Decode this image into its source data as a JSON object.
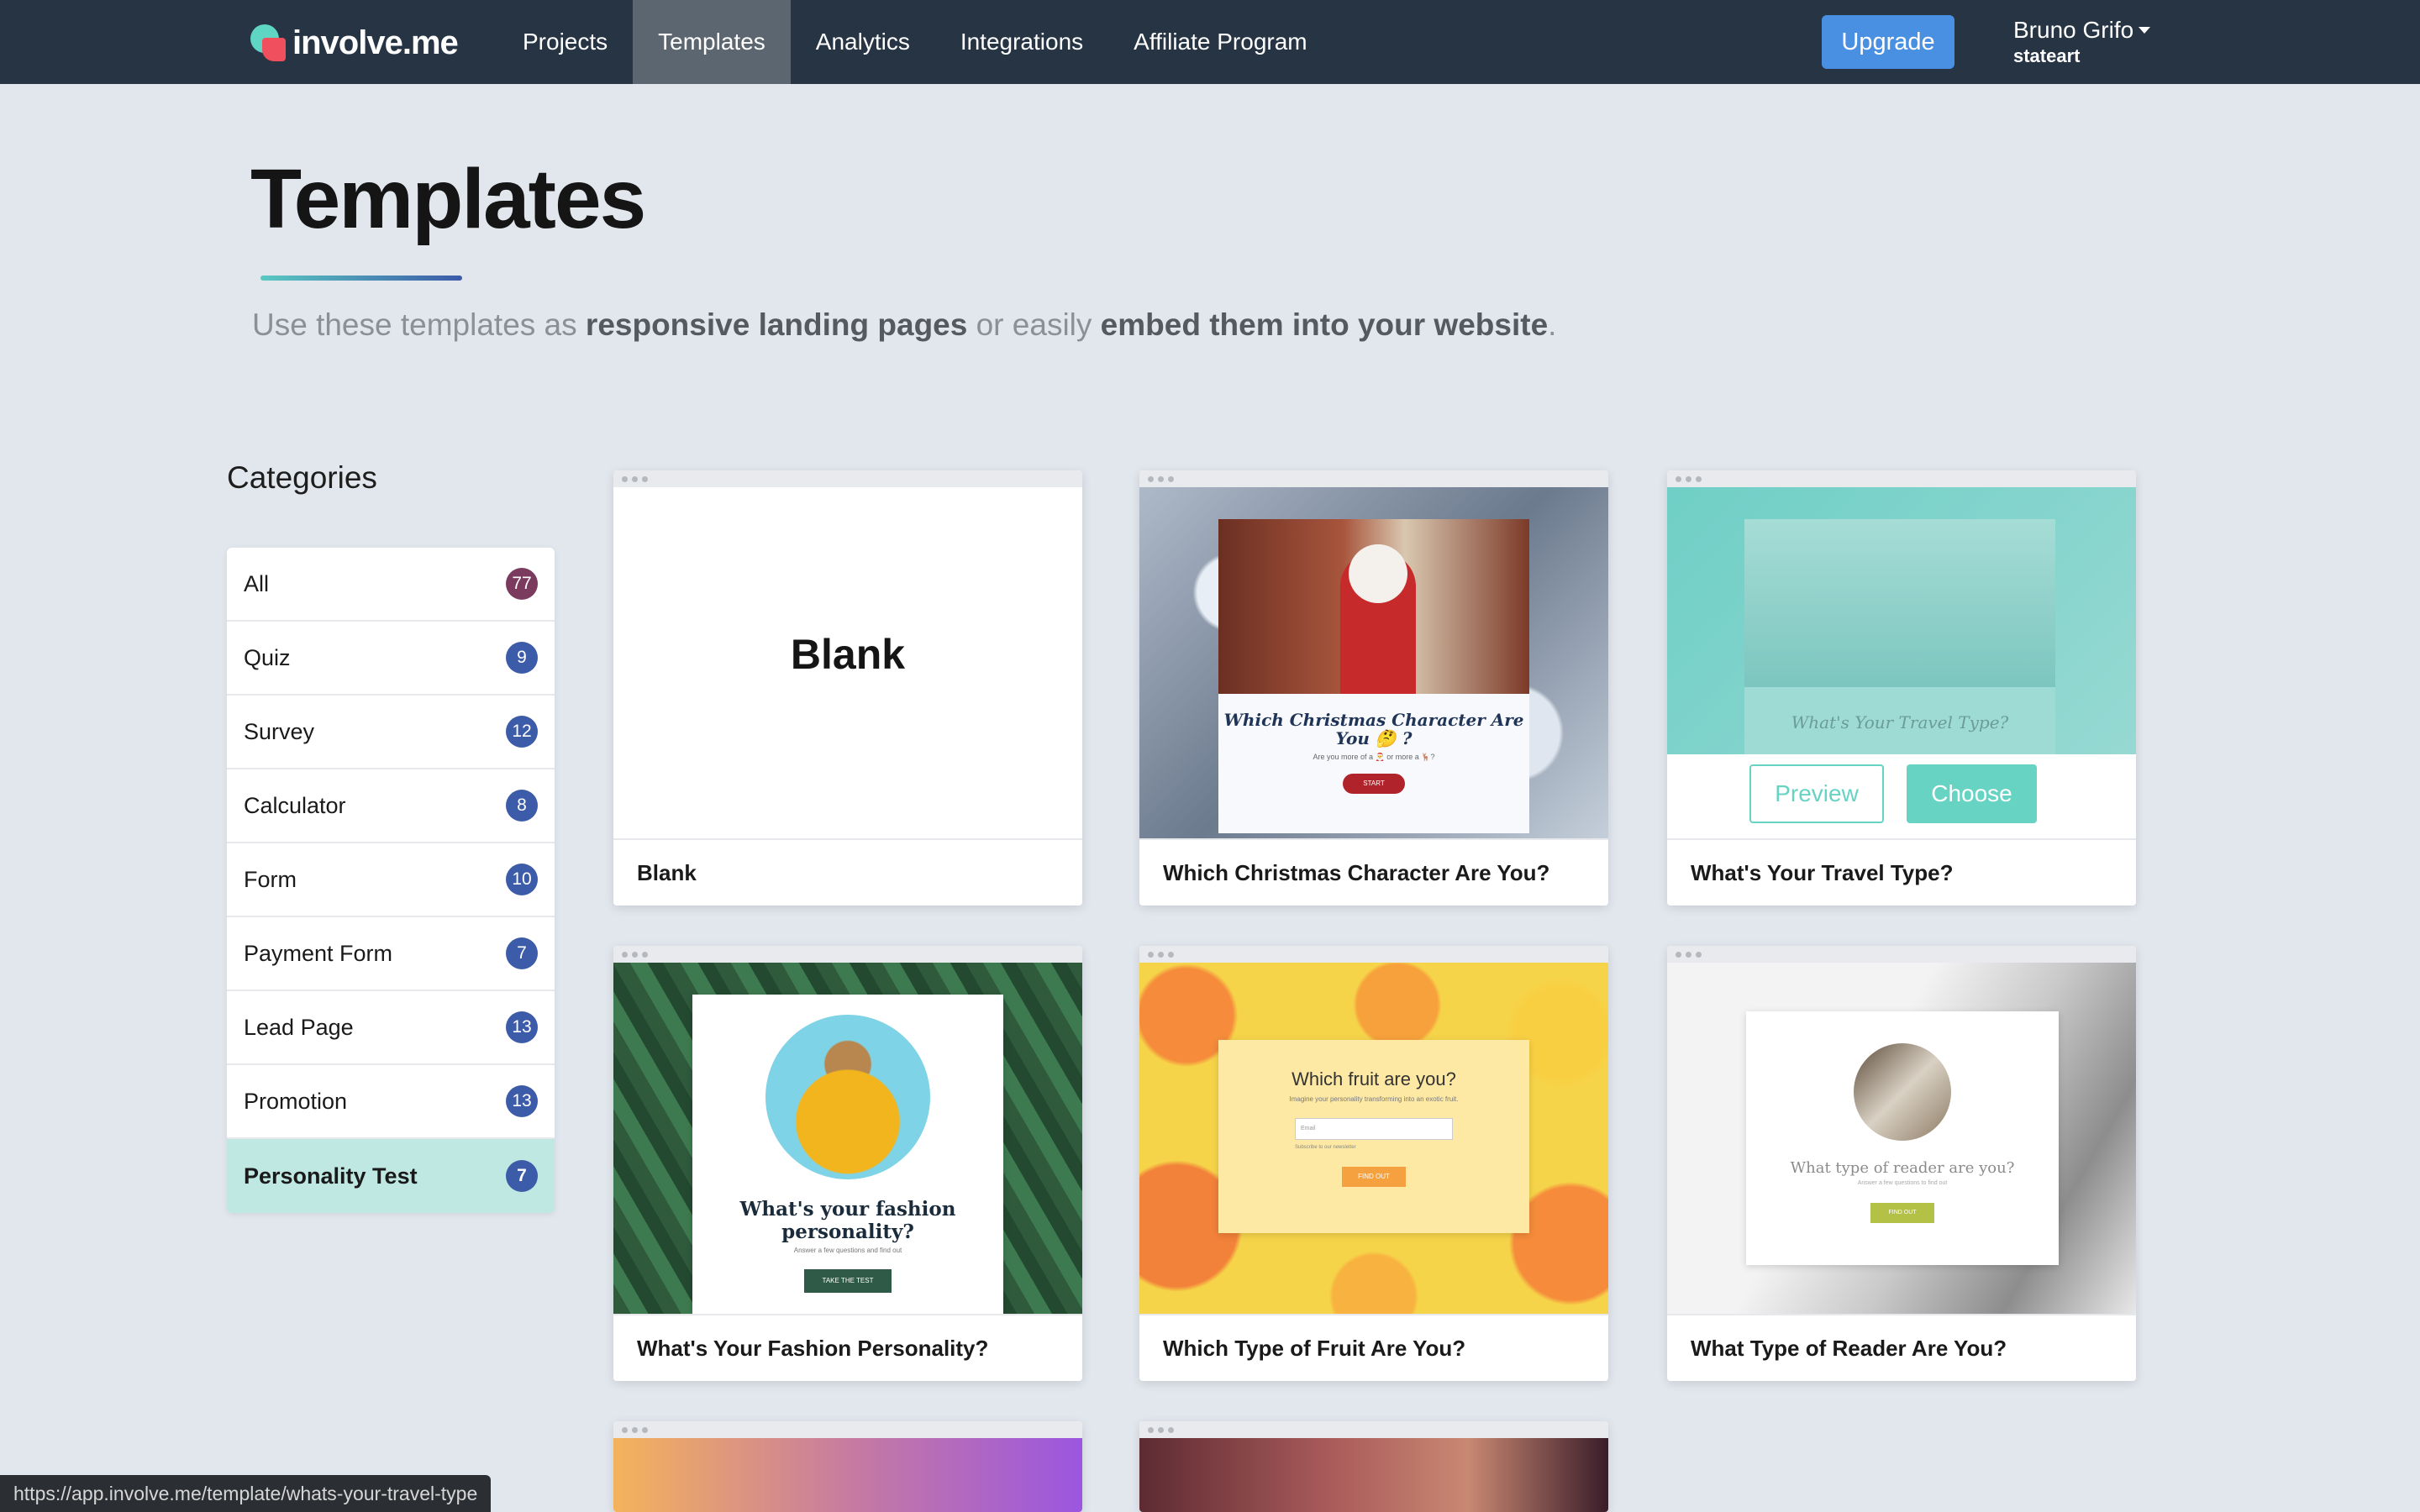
{
  "nav": {
    "logo": "involve.me",
    "items": [
      {
        "label": "Projects"
      },
      {
        "label": "Templates"
      },
      {
        "label": "Analytics"
      },
      {
        "label": "Integrations"
      },
      {
        "label": "Affiliate Program"
      }
    ],
    "active_item": "Templates",
    "upgrade_label": "Upgrade",
    "user_name": "Bruno Grifo",
    "user_workspace": "stateart"
  },
  "header": {
    "title": "Templates",
    "subtitle": {
      "part1": "Use these templates as ",
      "bold1": "responsive landing pages",
      "part2": " or easily ",
      "bold2": "embed them into your website",
      "part3": "."
    }
  },
  "categories": {
    "title": "Categories",
    "items": [
      {
        "label": "All",
        "count": "77"
      },
      {
        "label": "Quiz",
        "count": "9"
      },
      {
        "label": "Survey",
        "count": "12"
      },
      {
        "label": "Calculator",
        "count": "8"
      },
      {
        "label": "Form",
        "count": "10"
      },
      {
        "label": "Payment Form",
        "count": "7"
      },
      {
        "label": "Lead Page",
        "count": "13"
      },
      {
        "label": "Promotion",
        "count": "13"
      },
      {
        "label": "Personality Test",
        "count": "7"
      }
    ],
    "active_item": "Personality Test"
  },
  "templates": [
    {
      "title": "Blank",
      "thumb_text": "Blank"
    },
    {
      "title": "Which Christmas Character Are You?",
      "thumb_title": "Which Christmas Character Are You 🤔 ?",
      "thumb_sub": "Are you more of a 🎅 or more a 🦌?",
      "thumb_button": "START"
    },
    {
      "title": "What's Your Travel Type?",
      "thumb_title": "What's Your Travel Type?",
      "preview_label": "Preview",
      "choose_label": "Choose"
    },
    {
      "title": "What's Your Fashion Personality?",
      "thumb_title": "What's your fashion personality?",
      "thumb_sub": "Answer a few questions and find out",
      "thumb_button": "TAKE THE TEST"
    },
    {
      "title": "Which Type of Fruit Are You?",
      "thumb_title": "Which fruit are you?",
      "thumb_sub": "Imagine your personality transforming into an exotic fruit.",
      "thumb_input": "Email",
      "thumb_check": "Subscribe to our newsletter",
      "thumb_button": "FIND OUT"
    },
    {
      "title": "What Type of Reader Are You?",
      "thumb_title": "What type of reader are you?",
      "thumb_sub": "Answer a few questions to find out",
      "thumb_button": "FIND OUT"
    }
  ],
  "status_bar_url": "https://app.involve.me/template/whats-your-travel-type",
  "colors": {
    "nav_bg": "#263444",
    "upgrade": "#4a90e2",
    "accent_teal": "#67d3c3",
    "badge_blue": "#3c5ba9",
    "badge_all": "#7a3b5f",
    "active_category_bg": "#bfe8e3"
  }
}
